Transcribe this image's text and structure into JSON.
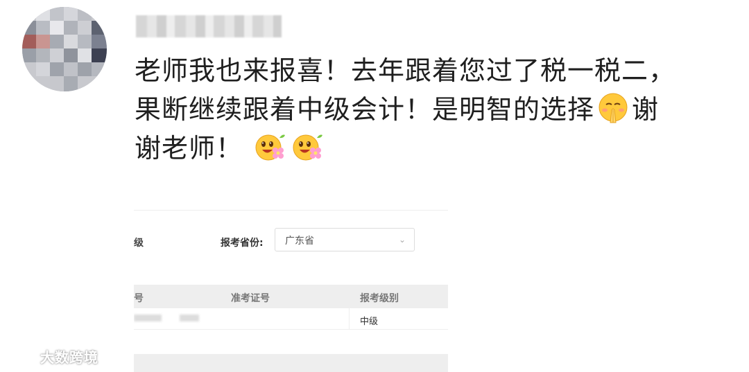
{
  "comment": {
    "line1": "老师我也来报喜！去年跟着您过了税一税二，",
    "line2a": "果断继续跟着中级会计！是明智的选择",
    "line2b": "谢",
    "line3": "谢老师！",
    "emojis": [
      "praying-hands-emoji",
      "flower-smile-emoji",
      "flower-smile-emoji"
    ]
  },
  "screenshot": {
    "level_label_partial": "级",
    "province_label": "报考省份:",
    "province_value": "广东省",
    "table": {
      "headers": [
        "号",
        "准考证号",
        "报考级别"
      ],
      "row": {
        "level": "中级"
      }
    }
  },
  "watermark": {
    "text": "大数跨境"
  },
  "colors": {
    "text": "#1f1f1f",
    "table_header": "#eeeeee",
    "emoji_yellow": "#ffc93c"
  }
}
